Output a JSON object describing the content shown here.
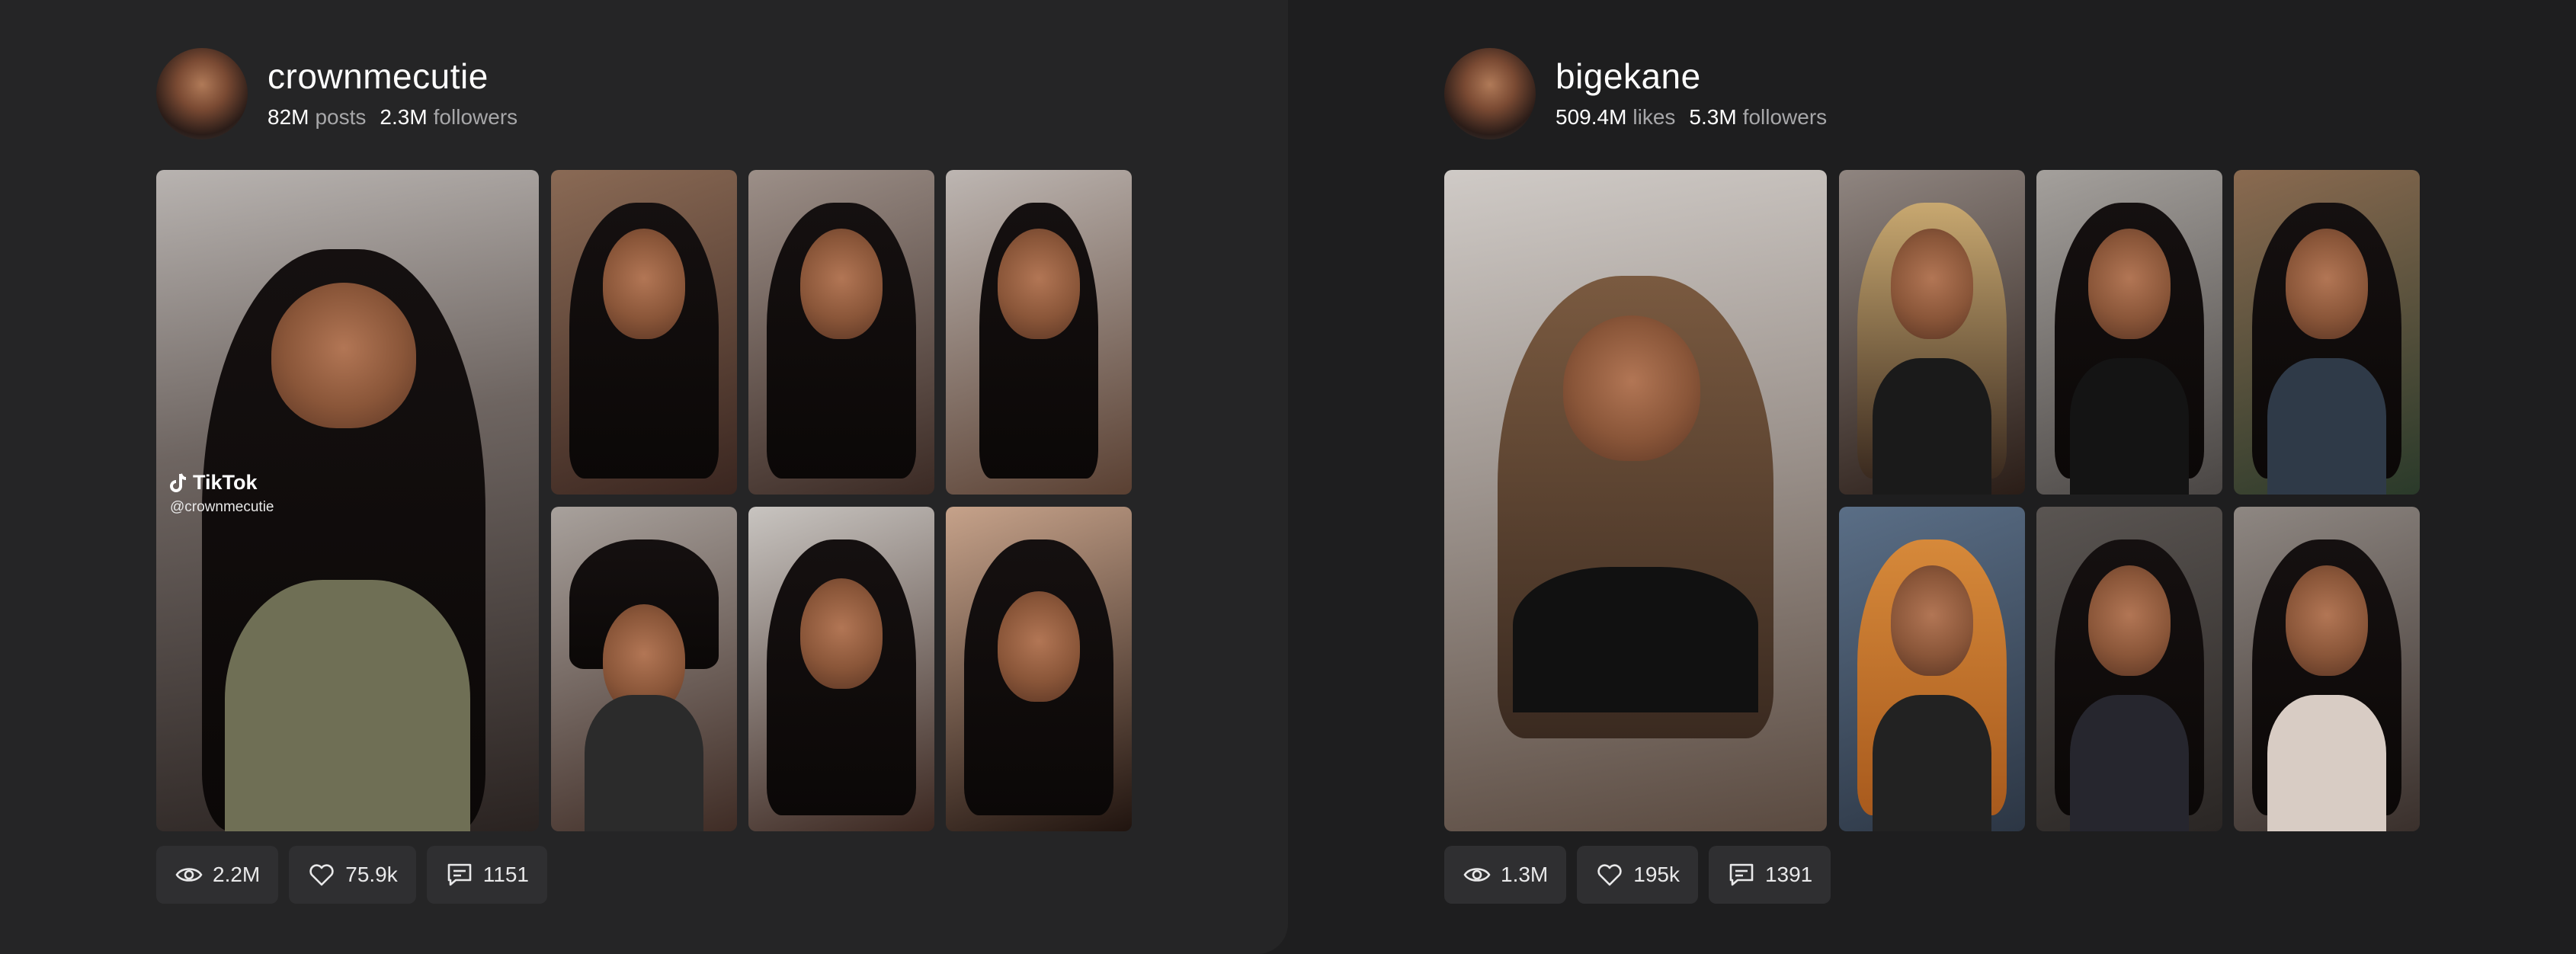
{
  "cards": [
    {
      "username": "crownmecutie",
      "stats": [
        {
          "value": "82M",
          "label": "posts"
        },
        {
          "value": "2.3M",
          "label": "followers"
        }
      ],
      "watermark": {
        "brand": "TikTok",
        "handle": "@crownmecutie"
      },
      "metrics": {
        "views": "2.2M",
        "likes": "75.9k",
        "comments": "1151"
      }
    },
    {
      "username": "bigekane",
      "stats": [
        {
          "value": "509.4M",
          "label": "likes"
        },
        {
          "value": "5.3M",
          "label": "followers"
        }
      ],
      "metrics": {
        "views": "1.3M",
        "likes": "195k",
        "comments": "1391"
      }
    }
  ],
  "colors": {
    "background": "#1e1e1f",
    "card_left": "#252526",
    "pill": "#2f2f31",
    "muted_text": "#a7a7a9",
    "text": "#ffffff"
  },
  "icons": {
    "views": "eye-icon",
    "likes": "heart-icon",
    "comments": "comment-icon",
    "brand": "tiktok-logo-icon"
  }
}
